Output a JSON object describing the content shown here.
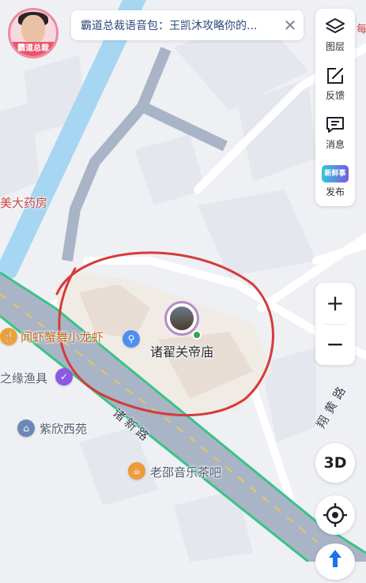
{
  "voice_pack": {
    "avatar_badge": "霸道总裁",
    "banner_text": "霸道总裁语音包：王凯沐攻略你的...",
    "close_icon": "close-icon"
  },
  "toolbar": {
    "items": [
      {
        "label": "图层",
        "icon": "layers-icon"
      },
      {
        "label": "反馈",
        "icon": "edit-icon"
      },
      {
        "label": "消息",
        "icon": "message-icon"
      },
      {
        "label": "发布",
        "icon": "publish-icon",
        "badge": "新鲜事"
      }
    ]
  },
  "zoom": {
    "in_label": "+",
    "out_label": "−"
  },
  "btn_3d": "3D",
  "edge_text": "每",
  "map": {
    "pois": [
      {
        "name": "美大药房",
        "color": "#c8473f"
      },
      {
        "name": "闻虾蟹舞小龙虾",
        "color": "#b8661c"
      },
      {
        "name": "之缘渔具",
        "color": "#4e5a6e"
      },
      {
        "name": "紫欣西苑",
        "color": "#4e5a6e"
      },
      {
        "name": "老邵音乐茶吧",
        "color": "#4e5a6e"
      },
      {
        "name": "诸翟关帝庙",
        "color": "#2b2f36"
      }
    ],
    "roads": [
      {
        "name": "诸新路"
      },
      {
        "name": "翔黄路"
      }
    ],
    "colors": {
      "accent_blue": "#1a73e8",
      "highway_green": "#38c486",
      "road_gray": "#a9b4c7",
      "annotation_red": "#d63a3a"
    }
  }
}
